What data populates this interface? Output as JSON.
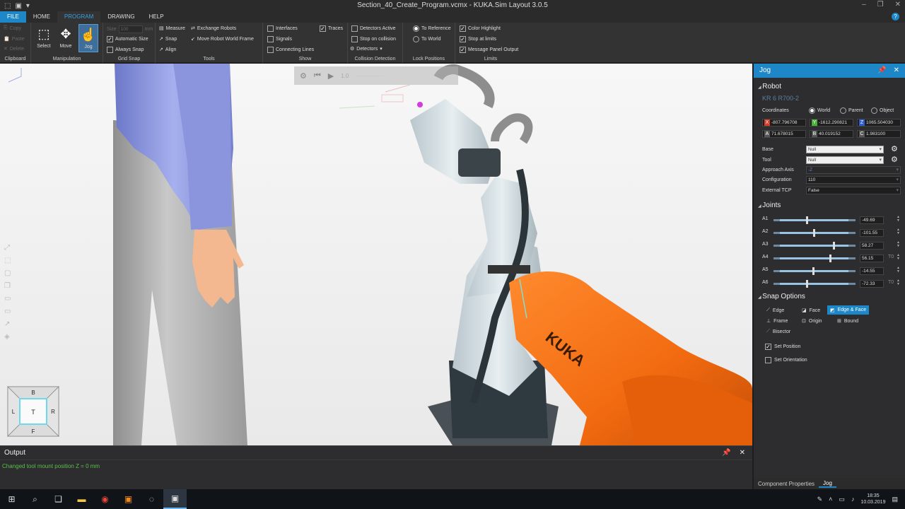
{
  "window": {
    "title": "Section_40_Create_Program.vcmx - KUKA.Sim Layout 3.0.5",
    "icons": [
      "app-logo-icon",
      "save-icon",
      "quick-access-icon"
    ],
    "controls": [
      "minimize-icon",
      "restore-icon",
      "close-icon"
    ]
  },
  "menu": {
    "file": "FILE",
    "home": "HOME",
    "program": "PROGRAM",
    "drawing": "DRAWING",
    "help": "HELP",
    "help_glyph": "?"
  },
  "ribbon": {
    "clipboard": {
      "copy": "Copy",
      "paste": "Paste",
      "delete": "Delete",
      "label": "Clipboard"
    },
    "manipulation": {
      "select": "Select",
      "move": "Move",
      "jog": "Jog",
      "label": "Manipulation"
    },
    "grid_snap": {
      "size": "Size",
      "size_value": "100",
      "size_unit": "mm",
      "automatic_size": "Automatic Size",
      "always_snap": "Always Snap",
      "label": "Grid Snap"
    },
    "tools": {
      "measure": "Measure",
      "snap": "Snap",
      "align": "Align",
      "exchange_robots": "Exchange Robots",
      "move_robot_world_frame": "Move Robot World Frame",
      "label": "Tools"
    },
    "show": {
      "interfaces": "Interfaces",
      "signals": "Signals",
      "connecting_lines": "Connecting Lines",
      "traces": "Traces",
      "label": "Show"
    },
    "collision": {
      "detectors_active": "Detectors Active",
      "stop_on_collision": "Stop on collision",
      "detectors": "Detectors",
      "label": "Collision Detection"
    },
    "lock": {
      "to_reference": "To Reference",
      "to_world": "To World",
      "label": "Lock Positions"
    },
    "limits": {
      "color_highlight": "Color Highlight",
      "stop_at_limits": "Stop at limits",
      "message_panel_output": "Message Panel Output",
      "label": "Limits"
    }
  },
  "viewport": {
    "speed": "1.0",
    "toolbar_icons": [
      "settings-icon",
      "rewind-icon",
      "play-icon"
    ],
    "cube": {
      "top": "T",
      "back": "B",
      "front": "F",
      "left": "L",
      "right": "R"
    },
    "robot_brand": "KUKA"
  },
  "jog": {
    "title": "Jog",
    "robot_section": "Robot",
    "robot_name": "KR 6 R700-2",
    "coordinates_label": "Coordinates",
    "coord_world": "World",
    "coord_parent": "Parent",
    "coord_object": "Object",
    "x_tag": "X",
    "x": "-807.796708",
    "y_tag": "Y",
    "y": "-1612.290821",
    "z_tag": "Z",
    "z": "1065.504030",
    "a_tag": "A",
    "a": "71.678015",
    "b_tag": "B",
    "b": "40.019152",
    "c_tag": "C",
    "c": "1.983100",
    "base_label": "Base",
    "base_value": "Null",
    "tool_label": "Tool",
    "tool_value": "Null",
    "approach_label": "Approach Axis",
    "approach_value": "-Z",
    "config_label": "Configuration",
    "config_value": "110",
    "ext_tcp_label": "External TCP",
    "ext_tcp_value": "False",
    "joints_section": "Joints",
    "joints": [
      {
        "name": "A1",
        "value": "-49.69",
        "level": 0.4
      },
      {
        "name": "A2",
        "value": "-101.55",
        "level": 0.48
      },
      {
        "name": "A3",
        "value": "58.27",
        "level": 0.72
      },
      {
        "name": "A4",
        "value": "56.15",
        "level": 0.68,
        "turn": "T0"
      },
      {
        "name": "A5",
        "value": "-14.55",
        "level": 0.47
      },
      {
        "name": "A6",
        "value": "-72.33",
        "level": 0.4,
        "turn": "T0"
      }
    ],
    "snap_section": "Snap Options",
    "snap_edge": "Edge",
    "snap_face": "Face",
    "snap_edge_face": "Edge & Face",
    "snap_frame": "Frame",
    "snap_origin": "Origin",
    "snap_bound": "Bound",
    "snap_bisector": "Bisector",
    "set_position": "Set Position",
    "set_orientation": "Set Orientation",
    "tab_component": "Component Properties",
    "tab_jog": "Jog"
  },
  "output": {
    "title": "Output",
    "message": "Changed tool mount position Z = 0 mm"
  },
  "taskbar": {
    "time": "18:35",
    "date": "10.03.2019",
    "icons": [
      "windows-start-icon",
      "search-icon",
      "task-view-icon",
      "file-explorer-icon",
      "chrome-icon",
      "app-f-icon",
      "app-circle-icon",
      "kuka-sim-icon"
    ]
  },
  "colors": {
    "accent": "#1e87c8",
    "robot_orange": "#f26a10",
    "robot_white": "#d8e2e6",
    "x_axis": "#d83b2a",
    "y_axis": "#4caf3c",
    "z_axis": "#2b5fd0"
  }
}
